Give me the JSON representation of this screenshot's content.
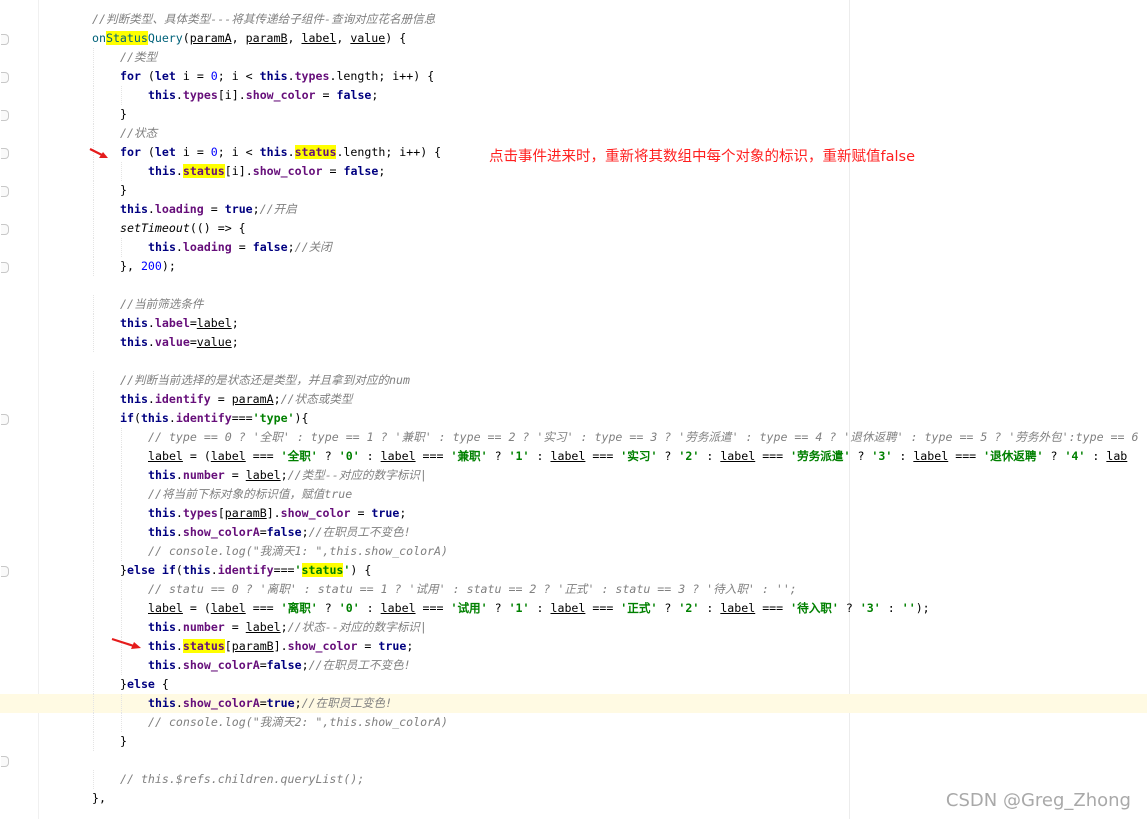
{
  "annotation": "点击事件进来时，重新将其数组中每个对象的标识，重新赋值false",
  "watermark": "CSDN @Greg_Zhong",
  "colors": {
    "keyword": "#000080",
    "number": "#0000ff",
    "string": "#008000",
    "comment": "#808080",
    "highlight": "#ffff00",
    "annotation": "#ff2020"
  },
  "icons": [
    "red-arrow-icon",
    "fold-marker-icon"
  ],
  "code": [
    {
      "indent": 0,
      "tokens": [
        {
          "t": "//判断类型、具体类型---将其传递给子组件-查询对应花名册信息",
          "c": "c"
        }
      ]
    },
    {
      "indent": 0,
      "tokens": [
        {
          "t": "on",
          "c": "fn"
        },
        {
          "t": "Status",
          "c": "fn hl"
        },
        {
          "t": "Query",
          "c": "fn"
        },
        {
          "t": "("
        },
        {
          "t": "paramA",
          "c": "u"
        },
        {
          "t": ", "
        },
        {
          "t": "paramB",
          "c": "u"
        },
        {
          "t": ", "
        },
        {
          "t": "label",
          "c": "u"
        },
        {
          "t": ", "
        },
        {
          "t": "value",
          "c": "u"
        },
        {
          "t": ") {"
        }
      ]
    },
    {
      "indent": 1,
      "tokens": [
        {
          "t": "//类型",
          "c": "c"
        }
      ]
    },
    {
      "indent": 1,
      "tokens": [
        {
          "t": "for",
          "c": "k"
        },
        {
          "t": " ("
        },
        {
          "t": "let",
          "c": "k"
        },
        {
          "t": " i = "
        },
        {
          "t": "0",
          "c": "n"
        },
        {
          "t": "; i < "
        },
        {
          "t": "this",
          "c": "k"
        },
        {
          "t": "."
        },
        {
          "t": "types",
          "c": "f"
        },
        {
          "t": ".length; i++) {"
        }
      ]
    },
    {
      "indent": 2,
      "tokens": [
        {
          "t": "this",
          "c": "k"
        },
        {
          "t": "."
        },
        {
          "t": "types",
          "c": "f"
        },
        {
          "t": "[i]."
        },
        {
          "t": "show_color",
          "c": "f"
        },
        {
          "t": " = "
        },
        {
          "t": "false",
          "c": "k"
        },
        {
          "t": ";"
        }
      ]
    },
    {
      "indent": 1,
      "tokens": [
        {
          "t": "}"
        }
      ]
    },
    {
      "indent": 1,
      "tokens": [
        {
          "t": "//状态",
          "c": "c"
        }
      ]
    },
    {
      "indent": 1,
      "tokens": [
        {
          "t": "for",
          "c": "k"
        },
        {
          "t": " ("
        },
        {
          "t": "let",
          "c": "k"
        },
        {
          "t": " i = "
        },
        {
          "t": "0",
          "c": "n"
        },
        {
          "t": "; i < "
        },
        {
          "t": "this",
          "c": "k"
        },
        {
          "t": "."
        },
        {
          "t": "status",
          "c": "f hl"
        },
        {
          "t": ".length; i++) {"
        }
      ]
    },
    {
      "indent": 2,
      "tokens": [
        {
          "t": "this",
          "c": "k"
        },
        {
          "t": "."
        },
        {
          "t": "status",
          "c": "f hl"
        },
        {
          "t": "[i]."
        },
        {
          "t": "show_color",
          "c": "f"
        },
        {
          "t": " = "
        },
        {
          "t": "false",
          "c": "k"
        },
        {
          "t": ";"
        }
      ]
    },
    {
      "indent": 1,
      "tokens": [
        {
          "t": "}"
        }
      ]
    },
    {
      "indent": 1,
      "tokens": [
        {
          "t": "this",
          "c": "k"
        },
        {
          "t": "."
        },
        {
          "t": "loading",
          "c": "f"
        },
        {
          "t": " = "
        },
        {
          "t": "true",
          "c": "k"
        },
        {
          "t": ";"
        },
        {
          "t": "//开启",
          "c": "c"
        }
      ]
    },
    {
      "indent": 1,
      "tokens": [
        {
          "t": "setTimeout",
          "c": "it"
        },
        {
          "t": "(() => {"
        }
      ]
    },
    {
      "indent": 2,
      "tokens": [
        {
          "t": "this",
          "c": "k"
        },
        {
          "t": "."
        },
        {
          "t": "loading",
          "c": "f"
        },
        {
          "t": " = "
        },
        {
          "t": "false",
          "c": "k"
        },
        {
          "t": ";"
        },
        {
          "t": "//关闭",
          "c": "c"
        }
      ]
    },
    {
      "indent": 1,
      "tokens": [
        {
          "t": "}, "
        },
        {
          "t": "200",
          "c": "n"
        },
        {
          "t": ");"
        }
      ]
    },
    {
      "indent": 0,
      "tokens": []
    },
    {
      "indent": 1,
      "tokens": [
        {
          "t": "//当前筛选条件",
          "c": "c"
        }
      ]
    },
    {
      "indent": 1,
      "tokens": [
        {
          "t": "this",
          "c": "k"
        },
        {
          "t": "."
        },
        {
          "t": "label",
          "c": "f"
        },
        {
          "t": "="
        },
        {
          "t": "label",
          "c": "u"
        },
        {
          "t": ";"
        }
      ]
    },
    {
      "indent": 1,
      "tokens": [
        {
          "t": "this",
          "c": "k"
        },
        {
          "t": "."
        },
        {
          "t": "value",
          "c": "f"
        },
        {
          "t": "="
        },
        {
          "t": "value",
          "c": "u"
        },
        {
          "t": ";"
        }
      ]
    },
    {
      "indent": 0,
      "tokens": []
    },
    {
      "indent": 1,
      "tokens": [
        {
          "t": "//判断当前选择的是状态还是类型，并且拿到对应的num",
          "c": "c"
        }
      ]
    },
    {
      "indent": 1,
      "tokens": [
        {
          "t": "this",
          "c": "k"
        },
        {
          "t": "."
        },
        {
          "t": "identify",
          "c": "f"
        },
        {
          "t": " = "
        },
        {
          "t": "paramA",
          "c": "u"
        },
        {
          "t": ";"
        },
        {
          "t": "//状态或类型",
          "c": "c"
        }
      ]
    },
    {
      "indent": 1,
      "tokens": [
        {
          "t": "if",
          "c": "k"
        },
        {
          "t": "("
        },
        {
          "t": "this",
          "c": "k"
        },
        {
          "t": "."
        },
        {
          "t": "identify",
          "c": "f"
        },
        {
          "t": "==="
        },
        {
          "t": "'type'",
          "c": "s"
        },
        {
          "t": "){"
        }
      ]
    },
    {
      "indent": 2,
      "tokens": [
        {
          "t": "// type == 0 ? '全职' : type == 1 ? '兼职' : type == 2 ? '实习' : type == 3 ? '劳务派遣' : type == 4 ? '退休返聘' : type == 5 ? '劳务外包':type == 6",
          "c": "c"
        }
      ]
    },
    {
      "indent": 2,
      "tokens": [
        {
          "t": "label",
          "c": "u"
        },
        {
          "t": " = ("
        },
        {
          "t": "label",
          "c": "u"
        },
        {
          "t": " === "
        },
        {
          "t": "'全职'",
          "c": "s"
        },
        {
          "t": " ? "
        },
        {
          "t": "'0'",
          "c": "s"
        },
        {
          "t": " : "
        },
        {
          "t": "label",
          "c": "u"
        },
        {
          "t": " === "
        },
        {
          "t": "'兼职'",
          "c": "s"
        },
        {
          "t": " ? "
        },
        {
          "t": "'1'",
          "c": "s"
        },
        {
          "t": " : "
        },
        {
          "t": "label",
          "c": "u"
        },
        {
          "t": " === "
        },
        {
          "t": "'实习'",
          "c": "s"
        },
        {
          "t": " ? "
        },
        {
          "t": "'2'",
          "c": "s"
        },
        {
          "t": " : "
        },
        {
          "t": "label",
          "c": "u"
        },
        {
          "t": " === "
        },
        {
          "t": "'劳务派遣'",
          "c": "s"
        },
        {
          "t": " ? "
        },
        {
          "t": "'3'",
          "c": "s"
        },
        {
          "t": " : "
        },
        {
          "t": "label",
          "c": "u"
        },
        {
          "t": " === "
        },
        {
          "t": "'退休返聘'",
          "c": "s"
        },
        {
          "t": " ? "
        },
        {
          "t": "'4'",
          "c": "s"
        },
        {
          "t": " : "
        },
        {
          "t": "lab",
          "c": "u"
        }
      ]
    },
    {
      "indent": 2,
      "tokens": [
        {
          "t": "this",
          "c": "k"
        },
        {
          "t": "."
        },
        {
          "t": "number",
          "c": "f"
        },
        {
          "t": " = "
        },
        {
          "t": "label",
          "c": "u"
        },
        {
          "t": ";"
        },
        {
          "t": "//类型--对应的数字标识|",
          "c": "c"
        }
      ]
    },
    {
      "indent": 2,
      "tokens": [
        {
          "t": "//将当前下标对象的标识值，赋值true",
          "c": "c"
        }
      ]
    },
    {
      "indent": 2,
      "tokens": [
        {
          "t": "this",
          "c": "k"
        },
        {
          "t": "."
        },
        {
          "t": "types",
          "c": "f"
        },
        {
          "t": "["
        },
        {
          "t": "paramB",
          "c": "u"
        },
        {
          "t": "]."
        },
        {
          "t": "show_color",
          "c": "f"
        },
        {
          "t": " = "
        },
        {
          "t": "true",
          "c": "k"
        },
        {
          "t": ";"
        }
      ]
    },
    {
      "indent": 2,
      "tokens": [
        {
          "t": "this",
          "c": "k"
        },
        {
          "t": "."
        },
        {
          "t": "show_colorA",
          "c": "f"
        },
        {
          "t": "="
        },
        {
          "t": "false",
          "c": "k"
        },
        {
          "t": ";"
        },
        {
          "t": "//在职员工不变色!",
          "c": "c"
        }
      ]
    },
    {
      "indent": 2,
      "tokens": [
        {
          "t": "// console.log(\"我滴天1: \",this.show_colorA)",
          "c": "c"
        }
      ]
    },
    {
      "indent": 1,
      "tokens": [
        {
          "t": "}"
        },
        {
          "t": "else if",
          "c": "k"
        },
        {
          "t": "("
        },
        {
          "t": "this",
          "c": "k"
        },
        {
          "t": "."
        },
        {
          "t": "identify",
          "c": "f"
        },
        {
          "t": "==="
        },
        {
          "t": "'",
          "c": "s"
        },
        {
          "t": "status",
          "c": "s hl"
        },
        {
          "t": "'",
          "c": "s"
        },
        {
          "t": ") {"
        }
      ]
    },
    {
      "indent": 2,
      "tokens": [
        {
          "t": "// statu == 0 ? '离职' : statu == 1 ? '试用' : statu == 2 ? '正式' : statu == 3 ? '待入职' : '';",
          "c": "c"
        }
      ]
    },
    {
      "indent": 2,
      "tokens": [
        {
          "t": "label",
          "c": "u"
        },
        {
          "t": " = ("
        },
        {
          "t": "label",
          "c": "u"
        },
        {
          "t": " === "
        },
        {
          "t": "'离职'",
          "c": "s"
        },
        {
          "t": " ? "
        },
        {
          "t": "'0'",
          "c": "s"
        },
        {
          "t": " : "
        },
        {
          "t": "label",
          "c": "u"
        },
        {
          "t": " === "
        },
        {
          "t": "'试用'",
          "c": "s"
        },
        {
          "t": " ? "
        },
        {
          "t": "'1'",
          "c": "s"
        },
        {
          "t": " : "
        },
        {
          "t": "label",
          "c": "u"
        },
        {
          "t": " === "
        },
        {
          "t": "'正式'",
          "c": "s"
        },
        {
          "t": " ? "
        },
        {
          "t": "'2'",
          "c": "s"
        },
        {
          "t": " : "
        },
        {
          "t": "label",
          "c": "u"
        },
        {
          "t": " === "
        },
        {
          "t": "'待入职'",
          "c": "s"
        },
        {
          "t": " ? "
        },
        {
          "t": "'3'",
          "c": "s"
        },
        {
          "t": " : "
        },
        {
          "t": "''",
          "c": "s"
        },
        {
          "t": ");"
        }
      ]
    },
    {
      "indent": 2,
      "tokens": [
        {
          "t": "this",
          "c": "k"
        },
        {
          "t": "."
        },
        {
          "t": "number",
          "c": "f"
        },
        {
          "t": " = "
        },
        {
          "t": "label",
          "c": "u"
        },
        {
          "t": ";"
        },
        {
          "t": "//状态--对应的数字标识|",
          "c": "c"
        }
      ]
    },
    {
      "indent": 2,
      "tokens": [
        {
          "t": "this",
          "c": "k"
        },
        {
          "t": "."
        },
        {
          "t": "status",
          "c": "f hl"
        },
        {
          "t": "["
        },
        {
          "t": "paramB",
          "c": "u"
        },
        {
          "t": "]."
        },
        {
          "t": "show_color",
          "c": "f"
        },
        {
          "t": " = "
        },
        {
          "t": "true",
          "c": "k"
        },
        {
          "t": ";"
        }
      ]
    },
    {
      "indent": 2,
      "tokens": [
        {
          "t": "this",
          "c": "k"
        },
        {
          "t": "."
        },
        {
          "t": "show_colorA",
          "c": "f"
        },
        {
          "t": "="
        },
        {
          "t": "false",
          "c": "k"
        },
        {
          "t": ";"
        },
        {
          "t": "//在职员工不变色!",
          "c": "c"
        }
      ]
    },
    {
      "indent": 1,
      "tokens": [
        {
          "t": "}"
        },
        {
          "t": "else",
          "c": "k"
        },
        {
          "t": " {"
        }
      ]
    },
    {
      "indent": 2,
      "current": true,
      "tokens": [
        {
          "t": "this",
          "c": "k"
        },
        {
          "t": "."
        },
        {
          "t": "show_colorA",
          "c": "f"
        },
        {
          "t": "="
        },
        {
          "t": "true",
          "c": "k"
        },
        {
          "t": ";"
        },
        {
          "t": "//在职员工变色!",
          "c": "c"
        }
      ]
    },
    {
      "indent": 2,
      "tokens": [
        {
          "t": "// console.log(\"我滴天2: \",this.show_colorA)",
          "c": "c"
        }
      ]
    },
    {
      "indent": 1,
      "tokens": [
        {
          "t": "}"
        }
      ]
    },
    {
      "indent": 0,
      "tokens": []
    },
    {
      "indent": 1,
      "tokens": [
        {
          "t": "// this.$refs.children.queryList();",
          "c": "c"
        }
      ]
    },
    {
      "indent": 0,
      "tokens": [
        {
          "t": "},"
        }
      ]
    }
  ]
}
